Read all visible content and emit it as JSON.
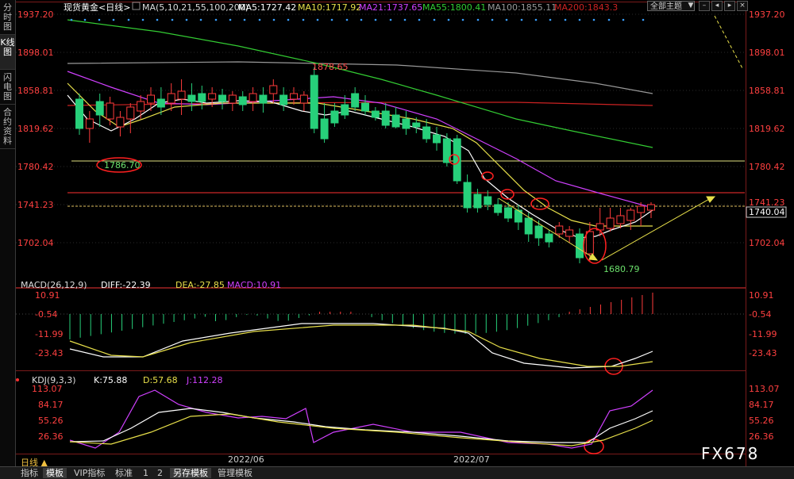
{
  "sidebar": {
    "tabs": [
      "分时图",
      "K线图",
      "闪电图",
      "合约资料"
    ]
  },
  "header": {
    "instrument": "现货黄金<日线>",
    "ma_label": "MA(5,10,21,55,100,200)",
    "ma5": "MA5:1727.42",
    "ma10": "MA10:1717.92",
    "ma21": "MA21:1737.65",
    "ma55": "MA55:1800.41",
    "ma100": "MA100:1855.11",
    "ma200": "MA200:1843.3",
    "theme": "全部主题"
  },
  "price_axis": {
    "ticks": [
      "1937.20",
      "1898.01",
      "1858.81",
      "1819.62",
      "1780.42",
      "1741.23",
      "1702.04"
    ],
    "last": "1740.04"
  },
  "annotations": {
    "high": "1878.65",
    "support": "1786.70",
    "low": "1680.79"
  },
  "macd": {
    "label": "MACD(26,12,9)",
    "diff": "DIFF:-22.39",
    "dea": "DEA:-27.85",
    "macd": "MACD:10.91",
    "ticks": [
      "10.91",
      "-0.54",
      "-11.99",
      "-23.43"
    ]
  },
  "kdj": {
    "label": "KDJ(9,3,3)",
    "k": "K:75.88",
    "d": "D:57.68",
    "j": "J:112.28",
    "ticks": [
      "113.07",
      "84.17",
      "55.26",
      "26.36"
    ]
  },
  "dates": [
    "2022/06",
    "2022/07"
  ],
  "footer": {
    "period": "日线",
    "tabs": [
      "指标",
      "模板",
      "VIP指标",
      "标准",
      "1",
      "2",
      "另存模板",
      "管理模板"
    ]
  },
  "watermark": "FX678",
  "colors": {
    "up": "#ff3b3b",
    "down": "#27d07a",
    "ma5": "#ffffff",
    "ma10": "#e8e04a",
    "ma21": "#d040ff",
    "ma55": "#33cc33",
    "ma100": "#999999",
    "ma200": "#cc2222"
  }
}
